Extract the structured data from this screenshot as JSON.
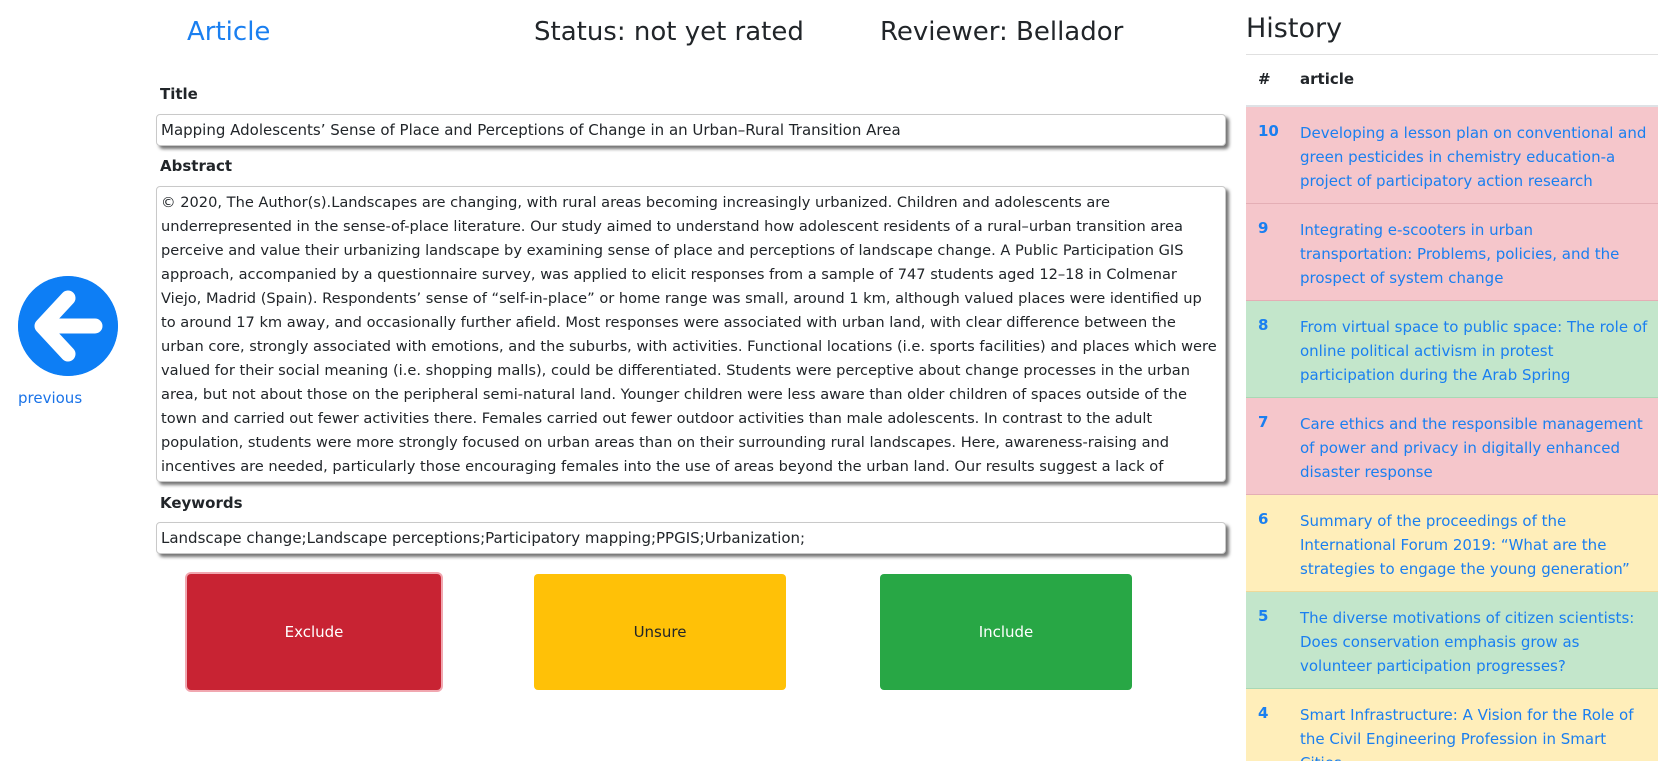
{
  "nav": {
    "previous_label": "previous",
    "previous_icon": "arrow-left-icon"
  },
  "header": {
    "article_link": "Article",
    "status": "Status: not yet rated",
    "reviewer": "Reviewer: Bellador"
  },
  "fields": {
    "title_label": "Title",
    "title_value": "Mapping Adolescents’ Sense of Place and Perceptions of Change in an Urban–Rural Transition Area",
    "abstract_label": "Abstract",
    "abstract_value": "© 2020, The Author(s).Landscapes are changing, with rural areas becoming increasingly urbanized. Children and adolescents are underrepresented in the sense-of-place literature. Our study aimed to understand how adolescent residents of a rural–urban transition area perceive and value their urbanizing landscape by examining sense of place and perceptions of landscape change. A Public Participation GIS approach, accompanied by a questionnaire survey, was applied to elicit responses from a sample of 747 students aged 12–18 in Colmenar Viejo, Madrid (Spain). Respondents’ sense of “self-in-place” or home range was small, around 1 km, although valued places were identified up to around 17 km away, and occasionally further afield. Most responses were associated with urban land, with clear difference between the urban core, strongly associated with emotions, and the suburbs, with activities. Functional locations (i.e. sports facilities) and places which were valued for their social meaning (i.e. shopping malls), could be differentiated. Students were perceptive about change processes in the urban area, but not about those on the peripheral semi-natural land. Younger children were less aware than older children of spaces outside of the town and carried out fewer activities there. Females carried out fewer outdoor activities than male adolescents. In contrast to the adult population, students were more strongly focused on urban areas than on their surrounding rural landscapes. Here, awareness-raising and incentives are needed, particularly those encouraging females into the use of areas beyond the urban land. Our results suggest a lack of meaningful integration between the core city and the periphery, with lessons for urban planners.",
    "keywords_label": "Keywords",
    "keywords_value": "Landscape change;Landscape perceptions;Participatory mapping;PPGIS;Urbanization;"
  },
  "actions": {
    "exclude": "Exclude",
    "unsure": "Unsure",
    "include": "Include",
    "colors": {
      "exclude": "#c82333",
      "unsure": "#ffc107",
      "include": "#28a745"
    }
  },
  "history": {
    "title": "History",
    "col_num": "#",
    "col_article": "article",
    "rows": [
      {
        "num": "10",
        "title": "Developing a lesson plan on conventional and green pesticides in chemistry education-a project of participatory action research",
        "status": "red"
      },
      {
        "num": "9",
        "title": "Integrating e-scooters in urban transportation: Problems, policies, and the prospect of system change",
        "status": "red"
      },
      {
        "num": "8",
        "title": "From virtual space to public space: The role of online political activism in protest participation during the Arab Spring",
        "status": "green"
      },
      {
        "num": "7",
        "title": "Care ethics and the responsible management of power and privacy in digitally enhanced disaster response",
        "status": "red"
      },
      {
        "num": "6",
        "title": "Summary of the proceedings of the International Forum 2019: “What are the strategies to engage the young generation”",
        "status": "yellow"
      },
      {
        "num": "5",
        "title": "The diverse motivations of citizen scientists: Does conservation emphasis grow as volunteer participation progresses?",
        "status": "green"
      },
      {
        "num": "4",
        "title": "Smart Infrastructure: A Vision for the Role of the Civil Engineering Profession in Smart Cities",
        "status": "yellow"
      }
    ]
  }
}
